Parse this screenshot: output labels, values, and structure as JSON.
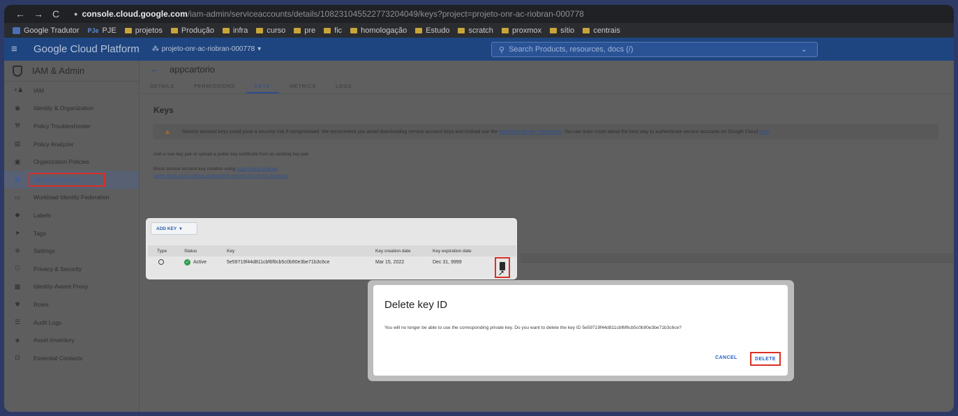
{
  "browser": {
    "host": "console.cloud.google.com",
    "path": "/iam-admin/serviceaccounts/details/108231045522773204049/keys?project=projeto-onr-ac-riobran-000778",
    "bookmarks": [
      "Google Tradutor",
      "PJE",
      "projetos",
      "Produção",
      "infra",
      "curso",
      "pre",
      "fic",
      "homologação",
      "Estudo",
      "scratch",
      "proxmox",
      "sítio",
      "centrais"
    ]
  },
  "header": {
    "title": "Google Cloud Platform",
    "project": "projeto-onr-ac-riobran-000778",
    "search_placeholder": "Search  Products, resources, docs (/)"
  },
  "sidebar": {
    "title": "IAM & Admin",
    "items": [
      {
        "label": "IAM",
        "icon": "person-add-icon"
      },
      {
        "label": "Identity & Organization",
        "icon": "account-circle-icon"
      },
      {
        "label": "Policy Troubleshooter",
        "icon": "wrench-icon"
      },
      {
        "label": "Policy Analyzer",
        "icon": "search-doc-icon"
      },
      {
        "label": "Organization Policies",
        "icon": "policy-icon"
      },
      {
        "label": "Service Accounts",
        "icon": "service-account-icon"
      },
      {
        "label": "Workload Identity Federation",
        "icon": "id-card-icon"
      },
      {
        "label": "Labels",
        "icon": "label-icon"
      },
      {
        "label": "Tags",
        "icon": "tag-icon"
      },
      {
        "label": "Settings",
        "icon": "gear-icon"
      },
      {
        "label": "Privacy & Security",
        "icon": "shield-icon"
      },
      {
        "label": "Identity-Aware Proxy",
        "icon": "proxy-icon"
      },
      {
        "label": "Roles",
        "icon": "roles-icon"
      },
      {
        "label": "Audit Logs",
        "icon": "list-icon"
      },
      {
        "label": "Asset Inventory",
        "icon": "diamond-icon"
      },
      {
        "label": "Essential Contacts",
        "icon": "contact-icon"
      }
    ]
  },
  "page": {
    "title": "appcartorio",
    "tabs": [
      "DETAILS",
      "PERMISSIONS",
      "KEYS",
      "METRICS",
      "LOGS"
    ],
    "section_title": "Keys",
    "warning_text": "Service account keys could pose a security risk if compromised. We recommend you avoid downloading service account keys and instead use the",
    "warning_link": "Workload Identity Federation",
    "warning_text2": ". You can learn more about the best way to authenticate service accounts on Google Cloud",
    "warning_link2": "here",
    "add_note": "Add a new key pair or upload a public key certificate from an existing key pair.",
    "block_note": "Block service account key creation using",
    "block_link": "organization policies",
    "learn_link": "Learn more about setting organization policies for service accounts"
  },
  "keys_table": {
    "add_key_label": "ADD KEY",
    "headers": [
      "Type",
      "Status",
      "Key",
      "Key creation date",
      "Key expiration date"
    ],
    "row": {
      "status": "Active",
      "key": "5e59719f44d811cbf6f6cb5c0b90e3be71b3c6ce",
      "created": "Mar 15, 2022",
      "expires": "Dec 31, 9999"
    }
  },
  "dialog": {
    "title": "Delete key ID",
    "text": "You will no longer be able to use the corresponding private key. Do you want to delete the key ID 5e59719f44d811cbf6f6cb5c0b90e3be71b3c6ce?",
    "cancel_label": "CANCEL",
    "delete_label": "DELETE"
  }
}
